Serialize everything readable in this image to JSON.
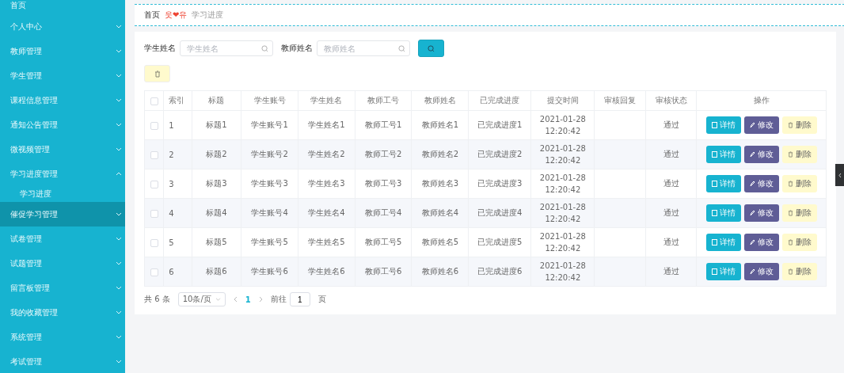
{
  "sidebar": {
    "items": [
      {
        "label": "首页",
        "kind": "link",
        "selected": false
      },
      {
        "label": "个人中心",
        "kind": "menu",
        "expanded": false,
        "selected": false
      },
      {
        "label": "教师管理",
        "kind": "menu",
        "expanded": false,
        "selected": false
      },
      {
        "label": "学生管理",
        "kind": "menu",
        "expanded": false,
        "selected": false
      },
      {
        "label": "课程信息管理",
        "kind": "menu",
        "expanded": false,
        "selected": false
      },
      {
        "label": "通知公告管理",
        "kind": "menu",
        "expanded": false,
        "selected": false
      },
      {
        "label": "微视频管理",
        "kind": "menu",
        "expanded": false,
        "selected": false
      },
      {
        "label": "学习进度管理",
        "kind": "menu",
        "expanded": true,
        "selected": false,
        "children": [
          {
            "label": "学习进度"
          }
        ]
      },
      {
        "label": "催促学习管理",
        "kind": "menu",
        "expanded": false,
        "selected": true
      },
      {
        "label": "试卷管理",
        "kind": "menu",
        "expanded": false,
        "selected": false
      },
      {
        "label": "试题管理",
        "kind": "menu",
        "expanded": false,
        "selected": false
      },
      {
        "label": "留言板管理",
        "kind": "menu",
        "expanded": false,
        "selected": false
      },
      {
        "label": "我的收藏管理",
        "kind": "menu",
        "expanded": false,
        "selected": false
      },
      {
        "label": "系统管理",
        "kind": "menu",
        "expanded": false,
        "selected": false
      },
      {
        "label": "考试管理",
        "kind": "menu",
        "expanded": false,
        "selected": false
      }
    ]
  },
  "breadcrumb": {
    "home": "首页",
    "separator": "웃❤유",
    "current": "学习进度"
  },
  "search": {
    "fields": [
      {
        "label": "学生姓名",
        "placeholder": "学生姓名"
      },
      {
        "label": "教师姓名",
        "placeholder": "教师姓名"
      }
    ]
  },
  "table": {
    "select_all_checked": false,
    "columns": [
      "索引",
      "标题",
      "学生账号",
      "学生姓名",
      "教师工号",
      "教师姓名",
      "已完成进度",
      "提交时间",
      "审核回复",
      "审核状态",
      "操作"
    ],
    "rows": [
      {
        "checked": false,
        "cells": [
          "1",
          "标题1",
          "学生账号1",
          "学生姓名1",
          "教师工号1",
          "教师姓名1",
          "已完成进度1",
          "2021-01-28 12:20:42",
          "",
          "通过"
        ],
        "actions": [
          {
            "kind": "detail",
            "label": "详情"
          },
          {
            "kind": "edit",
            "label": "修改"
          },
          {
            "kind": "delete",
            "label": "删除"
          }
        ]
      },
      {
        "checked": false,
        "cells": [
          "2",
          "标题2",
          "学生账号2",
          "学生姓名2",
          "教师工号2",
          "教师姓名2",
          "已完成进度2",
          "2021-01-28 12:20:42",
          "",
          "通过"
        ],
        "actions": [
          {
            "kind": "detail",
            "label": "详情"
          },
          {
            "kind": "edit",
            "label": "修改"
          },
          {
            "kind": "delete",
            "label": "删除"
          }
        ]
      },
      {
        "checked": false,
        "cells": [
          "3",
          "标题3",
          "学生账号3",
          "学生姓名3",
          "教师工号3",
          "教师姓名3",
          "已完成进度3",
          "2021-01-28 12:20:42",
          "",
          "通过"
        ],
        "actions": [
          {
            "kind": "detail",
            "label": "详情"
          },
          {
            "kind": "edit",
            "label": "修改"
          },
          {
            "kind": "delete",
            "label": "删除"
          }
        ]
      },
      {
        "checked": false,
        "cells": [
          "4",
          "标题4",
          "学生账号4",
          "学生姓名4",
          "教师工号4",
          "教师姓名4",
          "已完成进度4",
          "2021-01-28 12:20:42",
          "",
          "通过"
        ],
        "actions": [
          {
            "kind": "detail",
            "label": "详情"
          },
          {
            "kind": "edit",
            "label": "修改"
          },
          {
            "kind": "delete",
            "label": "删除"
          }
        ]
      },
      {
        "checked": false,
        "cells": [
          "5",
          "标题5",
          "学生账号5",
          "学生姓名5",
          "教师工号5",
          "教师姓名5",
          "已完成进度5",
          "2021-01-28 12:20:42",
          "",
          "通过"
        ],
        "actions": [
          {
            "kind": "detail",
            "label": "详情"
          },
          {
            "kind": "edit",
            "label": "修改"
          },
          {
            "kind": "delete",
            "label": "删除"
          }
        ]
      },
      {
        "checked": false,
        "cells": [
          "6",
          "标题6",
          "学生账号6",
          "学生姓名6",
          "教师工号6",
          "教师姓名6",
          "已完成进度6",
          "2021-01-28 12:20:42",
          "",
          "通过"
        ],
        "actions": [
          {
            "kind": "detail",
            "label": "详情"
          },
          {
            "kind": "edit",
            "label": "修改"
          },
          {
            "kind": "delete",
            "label": "删除"
          }
        ]
      }
    ]
  },
  "pagination": {
    "total": "共 6 条",
    "page_size": "10条/页",
    "pages": [
      {
        "label": "1",
        "selected": true
      }
    ],
    "goto_label": "前往",
    "goto_value": "1",
    "goto_suffix": "页"
  }
}
